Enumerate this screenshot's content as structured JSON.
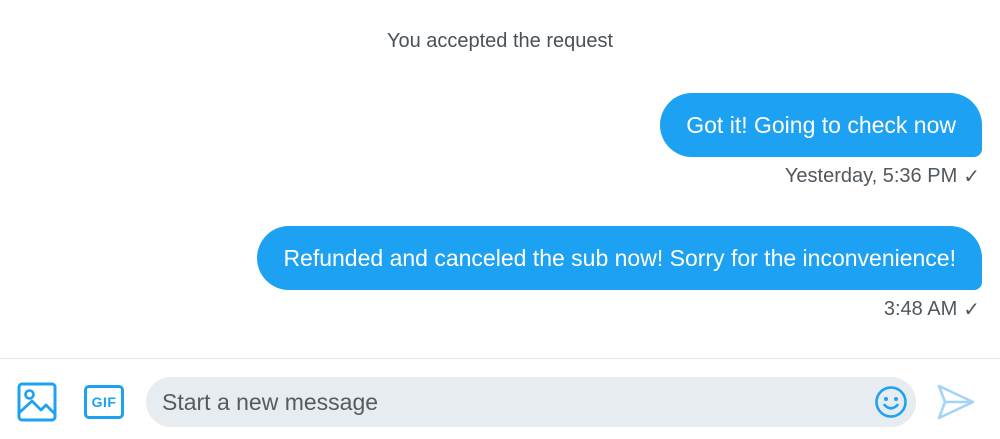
{
  "conversation": {
    "system_note": "You accepted the request",
    "messages": [
      {
        "text": "Got it! Going to check now",
        "timestamp": "Yesterday, 5:36 PM",
        "status": "✓"
      },
      {
        "text": "Refunded and canceled the sub now! Sorry for the inconvenience!",
        "timestamp": "3:48 AM",
        "status": "✓"
      }
    ]
  },
  "composer": {
    "placeholder": "Start a new message",
    "gif_label": "GIF",
    "icons": [
      "image-icon",
      "gif-icon",
      "emoji-icon",
      "send-icon"
    ]
  },
  "colors": {
    "accent": "#1da1f2",
    "bubble_text": "#ffffff",
    "input_bg": "#e6ecf0",
    "meta_text": "#50575d"
  }
}
